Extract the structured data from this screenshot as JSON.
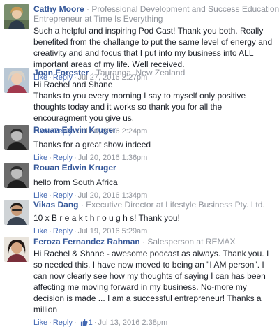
{
  "actions": {
    "like": "Like",
    "reply": "Reply",
    "dot": "·"
  },
  "comments": [
    {
      "name": "Cathy Moore",
      "headline": "Professional Development and Success Education",
      "subline": "Entrepreneur at Time Is Everything",
      "text": "Such a helpful and inspiring Pod Cast! Thank you both. Really benefited from the challange to put the same level of energy and creativity and and focus that I put into my business into ALL important areas of my life. Well received.",
      "time": "Jul 27, 2016 2:27pm"
    },
    {
      "name": "Joan Forester",
      "headline": "Tauranga, New Zealand",
      "text": "Hi Rachel and Shane\nThanks to you every morning I say to myself only positive thoughts today and it works so thank you for all the encouragment you give us.",
      "time": "Jul 20, 2016 2:24pm"
    },
    {
      "name": "Rouan Edwin Kruger",
      "text": "Thanks for a great show indeed",
      "time": "Jul 20, 2016 1:36pm"
    },
    {
      "name": "Rouan Edwin Kruger",
      "text": "hello from South Africa",
      "time": "Jul 20, 2016 1:34pm"
    },
    {
      "name": "Vikas Dang",
      "headline": "Executive Director at Lifestyle Business Pty. Ltd.",
      "text": "10 x B r e a k t h r o u g h s! Thank you!",
      "time": "Jul 19, 2016 5:29am"
    },
    {
      "name": "Feroza Fernandez Rahman",
      "headline": "Salesperson at REMAX",
      "text": "Hi Rachel & Shane - awesome podcast as always. Thank you. I so needed this. I have now moved to being an \"I AM person\". I can now clearly see how my thoughts of saying I can has been affecting me moving forward in my business. No-more my decision is made ... I am a successful entrepreneur! Thanks a million",
      "likes": "1",
      "time": "Jul 13, 2016 2:38pm"
    }
  ],
  "colors": {
    "name": "#365899",
    "link": "#4267b2",
    "meta": "#90949c",
    "text": "#1d2129"
  }
}
